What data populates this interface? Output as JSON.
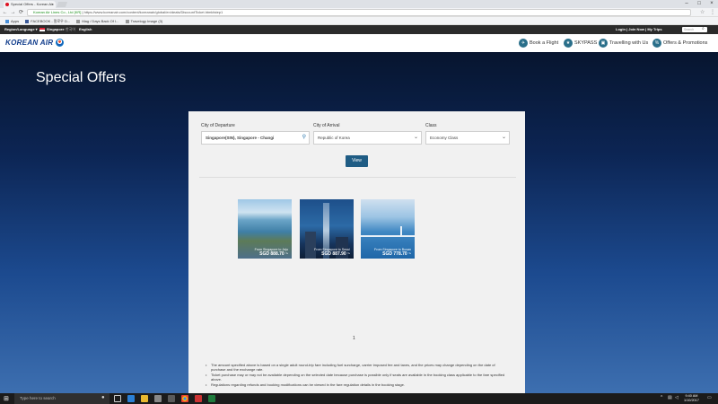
{
  "browser": {
    "tab_title": "Special Offers - Korean Air",
    "tab_close": "×",
    "window_buttons": [
      "–",
      "□",
      "×"
    ],
    "nav": {
      "back": "←",
      "forward": "→",
      "reload": "⟳"
    },
    "url_secure_label": "Korean Air Lines Co., Ltd [KR]",
    "url": "https://www.koreanair.com/content/koreanair/global/en/deals/DiscountTicket.html#step1",
    "bookmarks": [
      "Apps",
      "FACEBOOK - 팔로우 D...",
      "Mag / Days Back Of I...",
      "Travelogy Image (3)"
    ]
  },
  "utility": {
    "region_label": "Region/Language",
    "country": "Singapore",
    "lang_native": "한국어",
    "lang_current": "English",
    "links": "Login  |  Join Now  |  My Trips",
    "search_placeholder": "Search"
  },
  "nav": {
    "logo_text": "KOREAN AIR",
    "items": [
      "Book a Flight",
      "SKYPASS",
      "Travelling with Us",
      "Offers & Promotions"
    ]
  },
  "page": {
    "title": "Special Offers",
    "form": {
      "departure_label": "City of Departure",
      "departure_value": "Singapore(SIN), Singapore - Changi",
      "arrival_label": "City of Arrival",
      "arrival_value": "Republic of Korea",
      "class_label": "Class",
      "class_value": "Economy Class",
      "view_button": "View"
    },
    "offers": [
      {
        "route": "From Singapore to Jeju",
        "price": "SGD 888.70 ~"
      },
      {
        "route": "From Singapore to Seoul",
        "price": "SGD 887.90 ~"
      },
      {
        "route": "From Singapore to Busan",
        "price": "SGD 778.70 ~"
      }
    ],
    "pagination": "1",
    "notes": [
      "The amount specified above is based on a single adult round-trip fare including fuel surcharge, carrier imposed fee and taxes, and the prices may change depending on the date of purchase and the exchange rate.",
      "Ticket purchase may or may not be available depending on the selected date because purchase is possible only if seats are available in the booking class applicable to the fare specified above.",
      "Regulations regarding refunds and booking modifications can be viewed in the fare regulation details in the booking stage."
    ]
  },
  "taskbar": {
    "search_placeholder": "Type here to search",
    "time": "9:40 AM",
    "date": "1/10/2017"
  },
  "colors": {
    "brand_blue": "#0e3a8a",
    "nav_icon": "#2a6f8a",
    "view_button": "#1f5c84",
    "utility_bar": "#2b2b2b"
  }
}
